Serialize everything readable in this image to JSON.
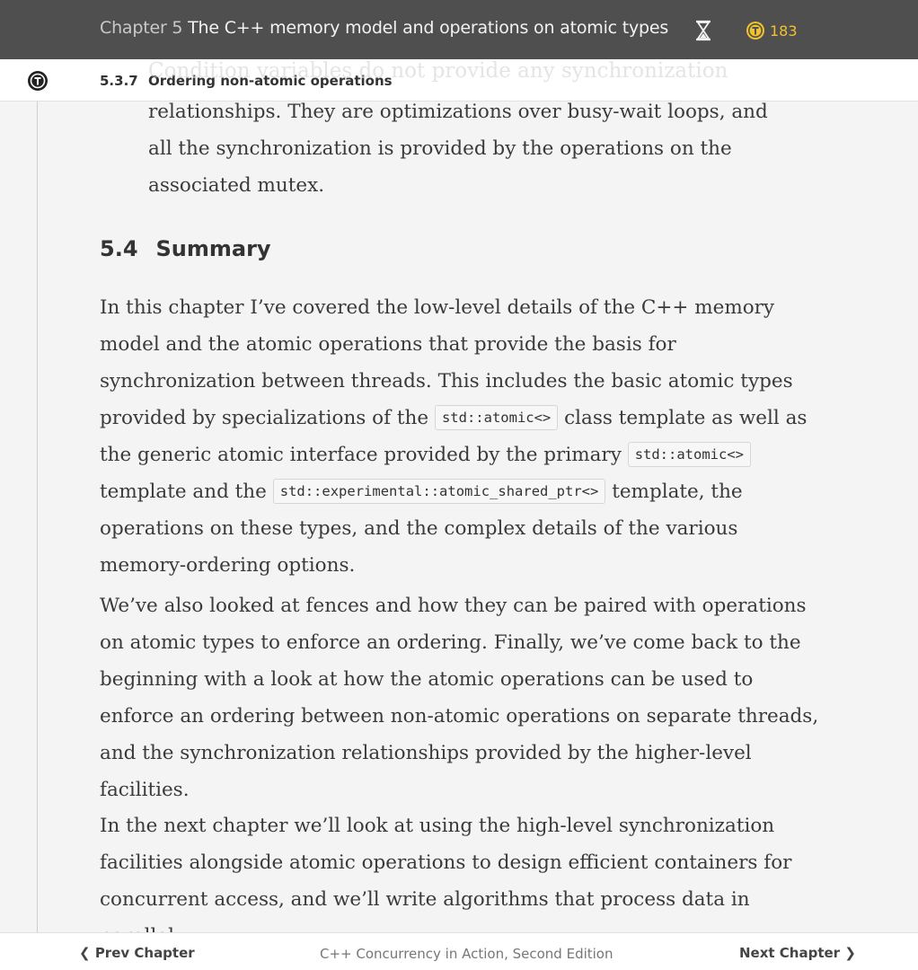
{
  "header": {
    "chapter_prefix": "Chapter 5",
    "chapter_title": "The C++ memory model and operations on atomic types",
    "token_count": "183"
  },
  "section_bar": {
    "number": "5.3.7",
    "title": "Ordering non-atomic operations",
    "faded_text": "Condition variables do not provide any synchronization"
  },
  "content": {
    "intro": "relationships. They are optimizations over busy-wait loops, and all the synchronization is provided by the operations on the associated mutex.",
    "summary_number": "5.4",
    "summary_title": "Summary",
    "p1": {
      "t1": "In this chapter I’ve covered the low-level details of the C++ memory model and the atomic operations that provide the basis for synchronization between threads. This includes the basic atomic types provided by specializations of the",
      "c1": "std::atomic<>",
      "t2": "class template as well as the generic atomic interface provided by the primary",
      "c2": "std::atomic<>",
      "t3": "template and the",
      "c3": "std::experimental::atomic_shared_ptr<>",
      "t4": "template, the operations on these types, and the complex details of the various memory-ordering options."
    },
    "p2": "We’ve also looked at fences and how they can be paired with operations on atomic types to enforce an ordering. Finally, we’ve come back to the beginning with a look at how the atomic operations can be used to enforce an ordering between non-atomic operations on separate threads, and the synchronization relationships provided by the higher-level facilities.",
    "p3": "In the next chapter we’ll look at using the high-level synchronization facilities alongside atomic operations to design efficient containers for concurrent access, and we’ll write algorithms that process data in parallel."
  },
  "footer": {
    "prev_label": "Prev Chapter",
    "book_title": "C++ Concurrency in Action, Second Edition",
    "next_label": "Next Chapter"
  },
  "colors": {
    "header_bg": "#4f4f4f",
    "token_accent": "#f2c12e",
    "page_bg": "#f4f4f4"
  },
  "icons": [
    "hourglass-icon",
    "token-icon",
    "section-logo-icon",
    "chevron-left-icon",
    "chevron-right-icon"
  ]
}
